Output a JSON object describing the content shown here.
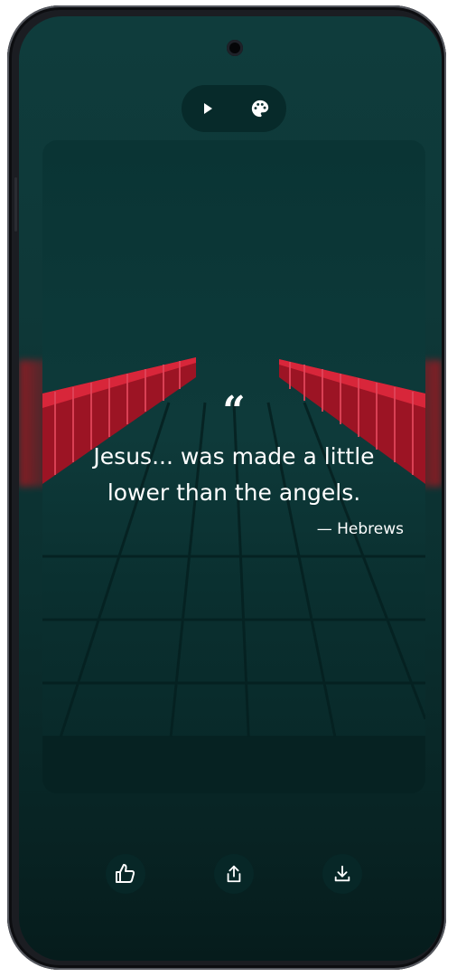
{
  "quote": {
    "text": "Jesus... was made a little lower than the angels.",
    "author": "— Hebrews",
    "mark": "“"
  },
  "top_controls": {
    "icons": [
      "play-icon",
      "palette-icon"
    ]
  },
  "actions": {
    "icons": [
      "thumbs-up-icon",
      "share-icon",
      "download-icon"
    ]
  },
  "colors": {
    "background": "#0e3838",
    "card": "#0a3232",
    "buttons": "#072828",
    "accent_red": "#c0182a",
    "text": "#ffffff"
  }
}
